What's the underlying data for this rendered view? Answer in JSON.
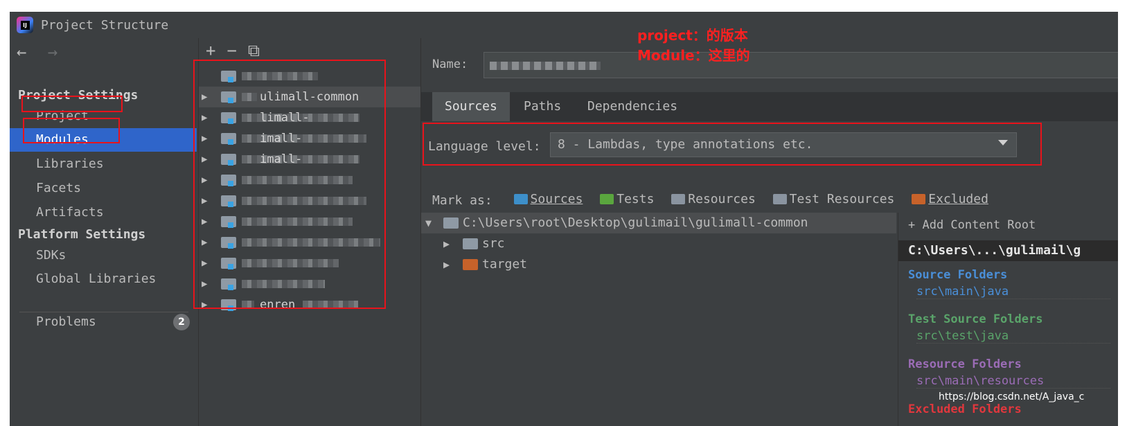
{
  "window": {
    "title": "Project Structure",
    "app_icon": "intellij-logo-icon"
  },
  "nav": {
    "back_icon": "arrow-left-icon",
    "forward_icon": "arrow-right-icon",
    "project_settings_heading": "Project Settings",
    "project_settings_items": [
      "Project",
      "Modules",
      "Libraries",
      "Facets",
      "Artifacts"
    ],
    "selected_item": "Modules",
    "platform_settings_heading": "Platform Settings",
    "platform_settings_items": [
      "SDKs",
      "Global Libraries"
    ],
    "problems_label": "Problems",
    "problems_count": "2"
  },
  "modules_toolbar": {
    "add_icon": "plus-icon",
    "remove_icon": "minus-icon",
    "copy_icon": "copy-icon"
  },
  "modules": [
    {
      "label": "",
      "expandable": false
    },
    {
      "label": "ulimall-common",
      "expandable": true,
      "selected": true
    },
    {
      "label": "limall-",
      "expandable": true
    },
    {
      "label": "imall-",
      "expandable": true
    },
    {
      "label": "imall-",
      "expandable": true
    },
    {
      "label": "",
      "expandable": true
    },
    {
      "label": "",
      "expandable": true
    },
    {
      "label": "",
      "expandable": true
    },
    {
      "label": "",
      "expandable": true
    },
    {
      "label": "",
      "expandable": true
    },
    {
      "label": "",
      "expandable": true
    },
    {
      "label": "enren",
      "expandable": true
    }
  ],
  "main": {
    "name_label": "Name:",
    "tabs": [
      "Sources",
      "Paths",
      "Dependencies"
    ],
    "active_tab": "Sources",
    "language_level_label": "Language level:",
    "language_level_value": "8 - Lambdas, type annotations etc.",
    "mark_as_label": "Mark as:",
    "mark_as": [
      {
        "label": "Sources",
        "color": "#3d8fc9"
      },
      {
        "label": "Tests",
        "color": "#5aa63e"
      },
      {
        "label": "Resources",
        "color": "#8a94a0"
      },
      {
        "label": "Test Resources",
        "color": "#8a94a0"
      },
      {
        "label": "Excluded",
        "color": "#c7622a"
      }
    ],
    "tree": [
      {
        "label": "C:\\Users\\root\\Desktop\\gulimail\\gulimall-common",
        "expanded": true,
        "folder_color": "#8f9aa5"
      },
      {
        "label": "src",
        "expanded": false,
        "folder_color": "#8f9aa5"
      },
      {
        "label": "target",
        "expanded": false,
        "folder_color": "#c7622a"
      }
    ],
    "add_content_root": "+ Add Content Root",
    "content_root_path": "C:\\Users\\...\\gulimail\\g",
    "source_folders_heading": "Source Folders",
    "source_folders_item": "src\\main\\java",
    "test_source_folders_heading": "Test Source Folders",
    "test_source_folders_item": "src\\test\\java",
    "resource_folders_heading": "Resource Folders",
    "resource_folders_item": "src\\main\\resources",
    "excluded_heading": "Excluded Folders",
    "colors": {
      "source": "#4a8fd8",
      "test": "#5aa46a",
      "resource": "#9b6cb6",
      "excluded": "#e0373d"
    }
  },
  "annotations": {
    "line1": "project：的版本",
    "line2": "Module：这里的",
    "color": "#ff2020"
  },
  "watermark": "https://blog.csdn.net/A_java_c"
}
